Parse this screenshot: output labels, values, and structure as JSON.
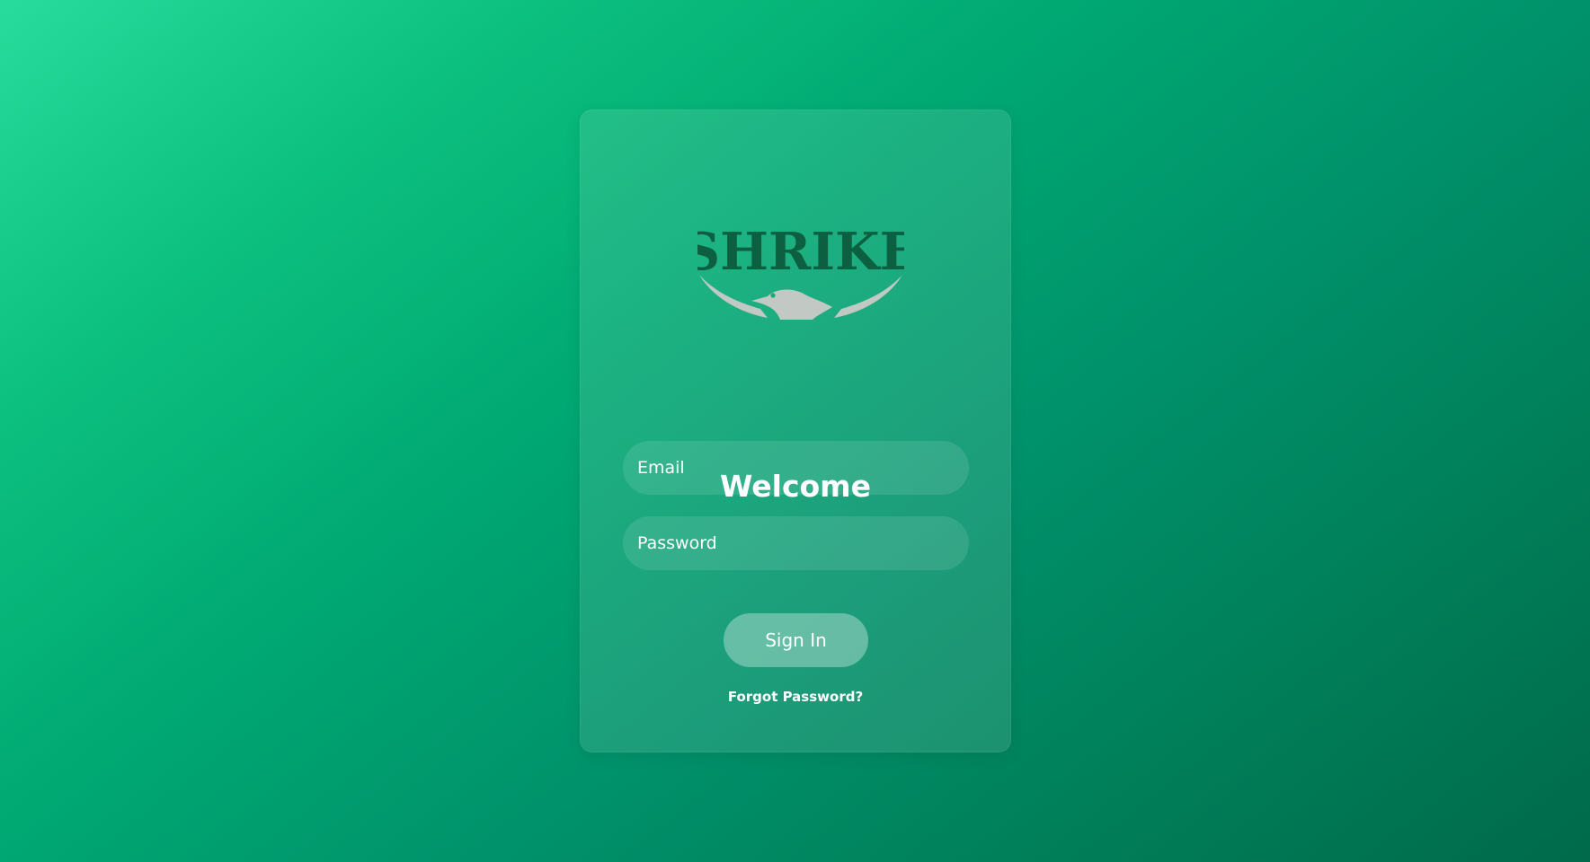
{
  "brand": {
    "logo_text": "SHRIKE",
    "logo_icon": "shrike-bird-emblem"
  },
  "login": {
    "heading": "Welcome",
    "email_placeholder": "Email",
    "password_placeholder": "Password",
    "signin_label": "Sign In",
    "forgot_label": "Forgot Password?"
  },
  "colors": {
    "background_start": "#27dc9c",
    "background_end": "#006a4a",
    "logo_text": "#0c5f40",
    "logo_emblem": "#c2c8c4",
    "text": "#ffffff"
  }
}
